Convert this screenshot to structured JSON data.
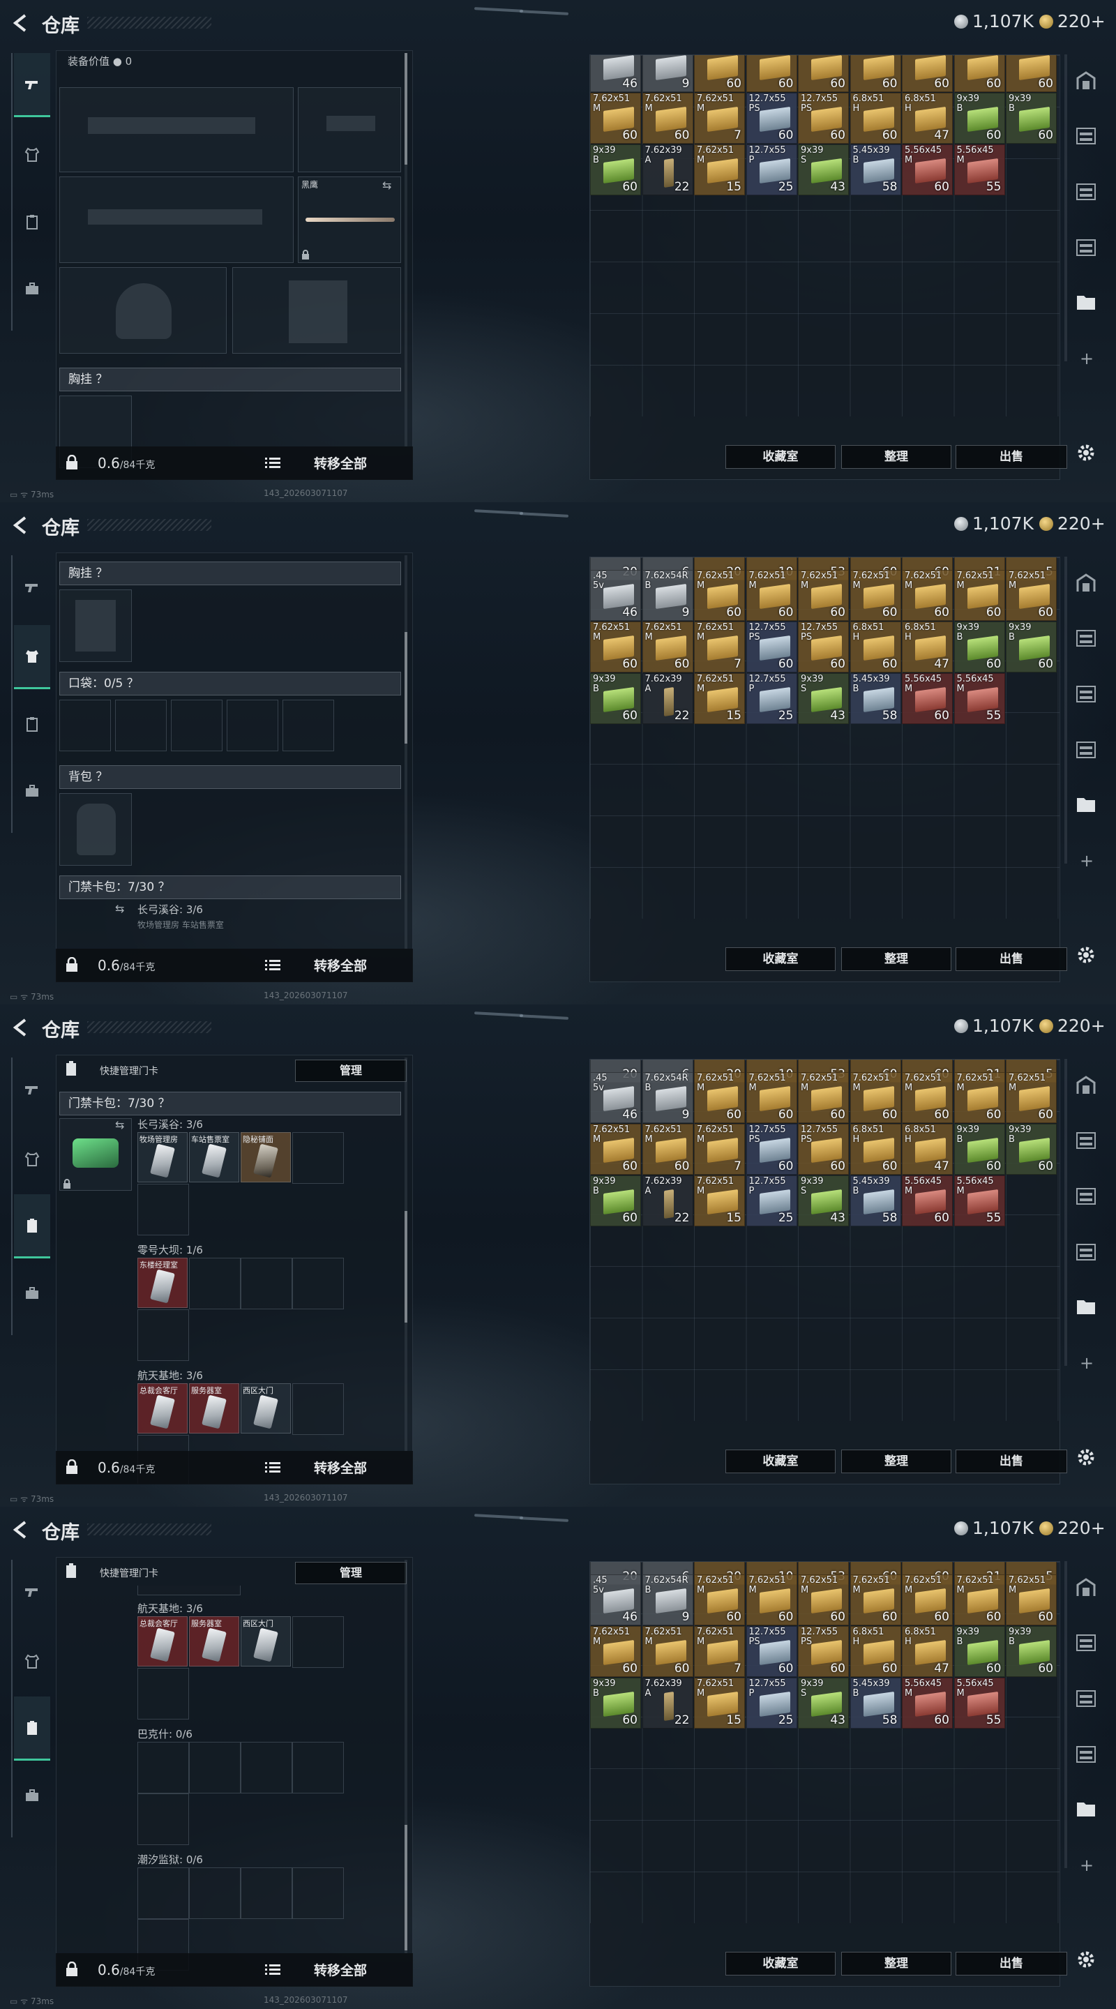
{
  "app": {
    "title": "仓库"
  },
  "currency": {
    "silver": "1,107K",
    "gold": "220+"
  },
  "footer": {
    "weight": "0.6",
    "weight_unit": "/84千克",
    "transfer_all": "转移全部"
  },
  "inventory_buttons": {
    "collection": "收藏室",
    "organize": "整理",
    "sell": "出售"
  },
  "status": {
    "ping": "73ms",
    "build": "143_202603071107"
  },
  "panel1": {
    "equipment_value_label": "装备价值",
    "equipment_value": "0",
    "melee_name": "黑鹰",
    "chest_rig": "胸挂 ？"
  },
  "panel2": {
    "chest_rig": "胸挂 ？",
    "pockets": "口袋：0/5 ？",
    "backpack": "背包 ？",
    "keycard_bag": "门禁卡包：7/30 ？",
    "zone_changgong": "长弓溪谷: 3/6",
    "zone_changgong_sub": "牧场管理房  车站售票室"
  },
  "panel3": {
    "quick_manage": "快捷管理门卡",
    "manage_btn": "管理",
    "keycard_bag": "门禁卡包：7/30 ？",
    "zone_changgong": "长弓溪谷: 3/6",
    "changgong_cards": [
      "牧场管理房",
      "车站售票室",
      "隐秘铺面"
    ],
    "zone_zero": "零号大坝: 1/6",
    "zero_cards": [
      "东楼经理室"
    ],
    "zone_space": "航天基地: 3/6",
    "space_cards": [
      "总裁会客厅",
      "服务器室",
      "西区大门"
    ]
  },
  "panel4": {
    "quick_manage": "快捷管理门卡",
    "manage_btn": "管理",
    "zone_space": "航天基地: 3/6",
    "space_cards": [
      "总裁会客厅",
      "服务器室",
      "西区大门"
    ],
    "zone_bakshi": "巴克什: 0/6",
    "zone_prison": "潮汐监狱: 0/6"
  },
  "inventory_top_row": [
    "20",
    "6",
    "20",
    "10",
    "53",
    "60",
    "60",
    "21",
    "5"
  ],
  "inventory_panel1": [
    [
      {
        "cal": "",
        "q": "46",
        "c": "grey"
      },
      {
        "cal": "",
        "q": "9",
        "c": "grey"
      },
      {
        "cal": "",
        "q": "60",
        "c": "gold"
      },
      {
        "cal": "",
        "q": "60",
        "c": "gold"
      },
      {
        "cal": "",
        "q": "60",
        "c": "gold"
      },
      {
        "cal": "",
        "q": "60",
        "c": "gold"
      },
      {
        "cal": "",
        "q": "60",
        "c": "gold"
      },
      {
        "cal": "",
        "q": "60",
        "c": "gold"
      },
      {
        "cal": "",
        "q": "60",
        "c": "gold"
      }
    ],
    [
      {
        "cal": "7.62x51\nM",
        "q": "60",
        "c": "gold"
      },
      {
        "cal": "7.62x51\nM",
        "q": "60",
        "c": "gold"
      },
      {
        "cal": "7.62x51\nM",
        "q": "7",
        "c": "gold"
      },
      {
        "cal": "12.7x55\nPS",
        "q": "60",
        "c": "blue"
      },
      {
        "cal": "12.7x55\nPS",
        "q": "60",
        "c": "gold"
      },
      {
        "cal": "6.8x51\nH",
        "q": "60",
        "c": "gold"
      },
      {
        "cal": "6.8x51\nH",
        "q": "47",
        "c": "gold"
      },
      {
        "cal": "9x39\nB",
        "q": "60",
        "c": "green"
      },
      {
        "cal": "9x39\nB",
        "q": "60",
        "c": "green"
      }
    ],
    [
      {
        "cal": "9x39\nB",
        "q": "60",
        "c": "green"
      },
      {
        "cal": "7.62x39\nA",
        "q": "22",
        "c": "dark"
      },
      {
        "cal": "7.62x51\nM",
        "q": "15",
        "c": "gold"
      },
      {
        "cal": "12.7x55\nP",
        "q": "25",
        "c": "blue"
      },
      {
        "cal": "9x39\nS",
        "q": "43",
        "c": "green"
      },
      {
        "cal": "5.45x39\nB",
        "q": "58",
        "c": "blue"
      },
      {
        "cal": "5.56x45\nM",
        "q": "60",
        "c": "red"
      },
      {
        "cal": "5.56x45\nM",
        "q": "55",
        "c": "red"
      }
    ]
  ],
  "inventory_main": [
    [
      {
        "cal": ".45\n5v",
        "q": "46",
        "c": "grey"
      },
      {
        "cal": "7.62x54R\nB",
        "q": "9",
        "c": "grey"
      },
      {
        "cal": "7.62x51\nM",
        "q": "60",
        "c": "gold"
      },
      {
        "cal": "7.62x51\nM",
        "q": "60",
        "c": "gold"
      },
      {
        "cal": "7.62x51\nM",
        "q": "60",
        "c": "gold"
      },
      {
        "cal": "7.62x51\nM",
        "q": "60",
        "c": "gold"
      },
      {
        "cal": "7.62x51\nM",
        "q": "60",
        "c": "gold"
      },
      {
        "cal": "7.62x51\nM",
        "q": "60",
        "c": "gold"
      },
      {
        "cal": "7.62x51\nM",
        "q": "60",
        "c": "gold"
      }
    ],
    [
      {
        "cal": "7.62x51\nM",
        "q": "60",
        "c": "gold"
      },
      {
        "cal": "7.62x51\nM",
        "q": "60",
        "c": "gold"
      },
      {
        "cal": "7.62x51\nM",
        "q": "7",
        "c": "gold"
      },
      {
        "cal": "12.7x55\nPS",
        "q": "60",
        "c": "blue"
      },
      {
        "cal": "12.7x55\nPS",
        "q": "60",
        "c": "gold"
      },
      {
        "cal": "6.8x51\nH",
        "q": "60",
        "c": "gold"
      },
      {
        "cal": "6.8x51\nH",
        "q": "47",
        "c": "gold"
      },
      {
        "cal": "9x39\nB",
        "q": "60",
        "c": "green"
      },
      {
        "cal": "9x39\nB",
        "q": "60",
        "c": "green"
      }
    ],
    [
      {
        "cal": "9x39\nB",
        "q": "60",
        "c": "green"
      },
      {
        "cal": "7.62x39\nA",
        "q": "22",
        "c": "dark"
      },
      {
        "cal": "7.62x51\nM",
        "q": "15",
        "c": "gold"
      },
      {
        "cal": "12.7x55\nP",
        "q": "25",
        "c": "blue"
      },
      {
        "cal": "9x39\nS",
        "q": "43",
        "c": "green"
      },
      {
        "cal": "5.45x39\nB",
        "q": "58",
        "c": "blue"
      },
      {
        "cal": "5.56x45\nM",
        "q": "60",
        "c": "red"
      },
      {
        "cal": "5.56x45\nM",
        "q": "55",
        "c": "red"
      }
    ]
  ],
  "colors": {
    "accent": "#3fc79c",
    "gold_item": "#6e5428",
    "red_item": "#5e2c2c",
    "green_item": "#3a4832",
    "blue_item": "#343e56"
  },
  "icons": {
    "back": "back-arrow-icon",
    "gear": "gear-icon",
    "lock": "lock-icon",
    "list": "list-icon",
    "plus": "plus-icon"
  }
}
